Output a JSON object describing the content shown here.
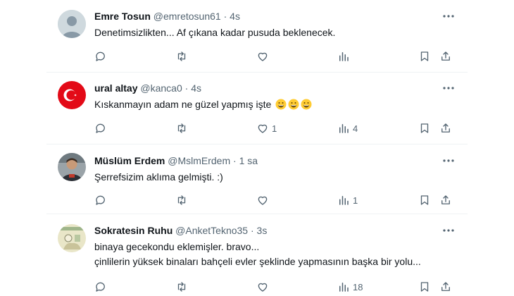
{
  "tweets": [
    {
      "name": "Emre Tosun",
      "handle": "@emretosun61",
      "separator": "·",
      "time": "4s",
      "text_lines": [
        "Denetimsizlikten... Af çıkana kadar pusuda beklenecek."
      ],
      "avatar": "default-profile",
      "counts": {
        "reply": "",
        "retweet": "",
        "like": "",
        "views": ""
      }
    },
    {
      "name": "ural altay",
      "handle": "@kanca0",
      "separator": "·",
      "time": "4s",
      "text_lines": [
        "Kıskanmayın adam ne güzel yapmış işte"
      ],
      "emojis": [
        "grinning-face",
        "grinning-face",
        "grinning-face"
      ],
      "avatar": "turkish-flag",
      "counts": {
        "reply": "",
        "retweet": "",
        "like": "1",
        "views": "4"
      }
    },
    {
      "name": "Müslüm Erdem",
      "handle": "@MslmErdem",
      "separator": "·",
      "time": "1 sa",
      "text_lines": [
        "Şerrefsizim aklıma gelmişti.  :)"
      ],
      "avatar": "person-photo",
      "counts": {
        "reply": "",
        "retweet": "",
        "like": "",
        "views": "1"
      }
    },
    {
      "name": "Sokratesin Ruhu",
      "handle": "@AnketTekno35",
      "separator": "·",
      "time": "3s",
      "text_lines": [
        "binaya gecekondu eklemişler. bravo...",
        "çinlilerin yüksek binaları bahçeli evler şeklinde yapmasının başka bir yolu..."
      ],
      "avatar": "figure-drawing",
      "counts": {
        "reply": "",
        "retweet": "",
        "like": "",
        "views": "18"
      }
    }
  ],
  "colors": {
    "text": "#0f1419",
    "muted": "#536471",
    "divider": "#eff3f4"
  }
}
